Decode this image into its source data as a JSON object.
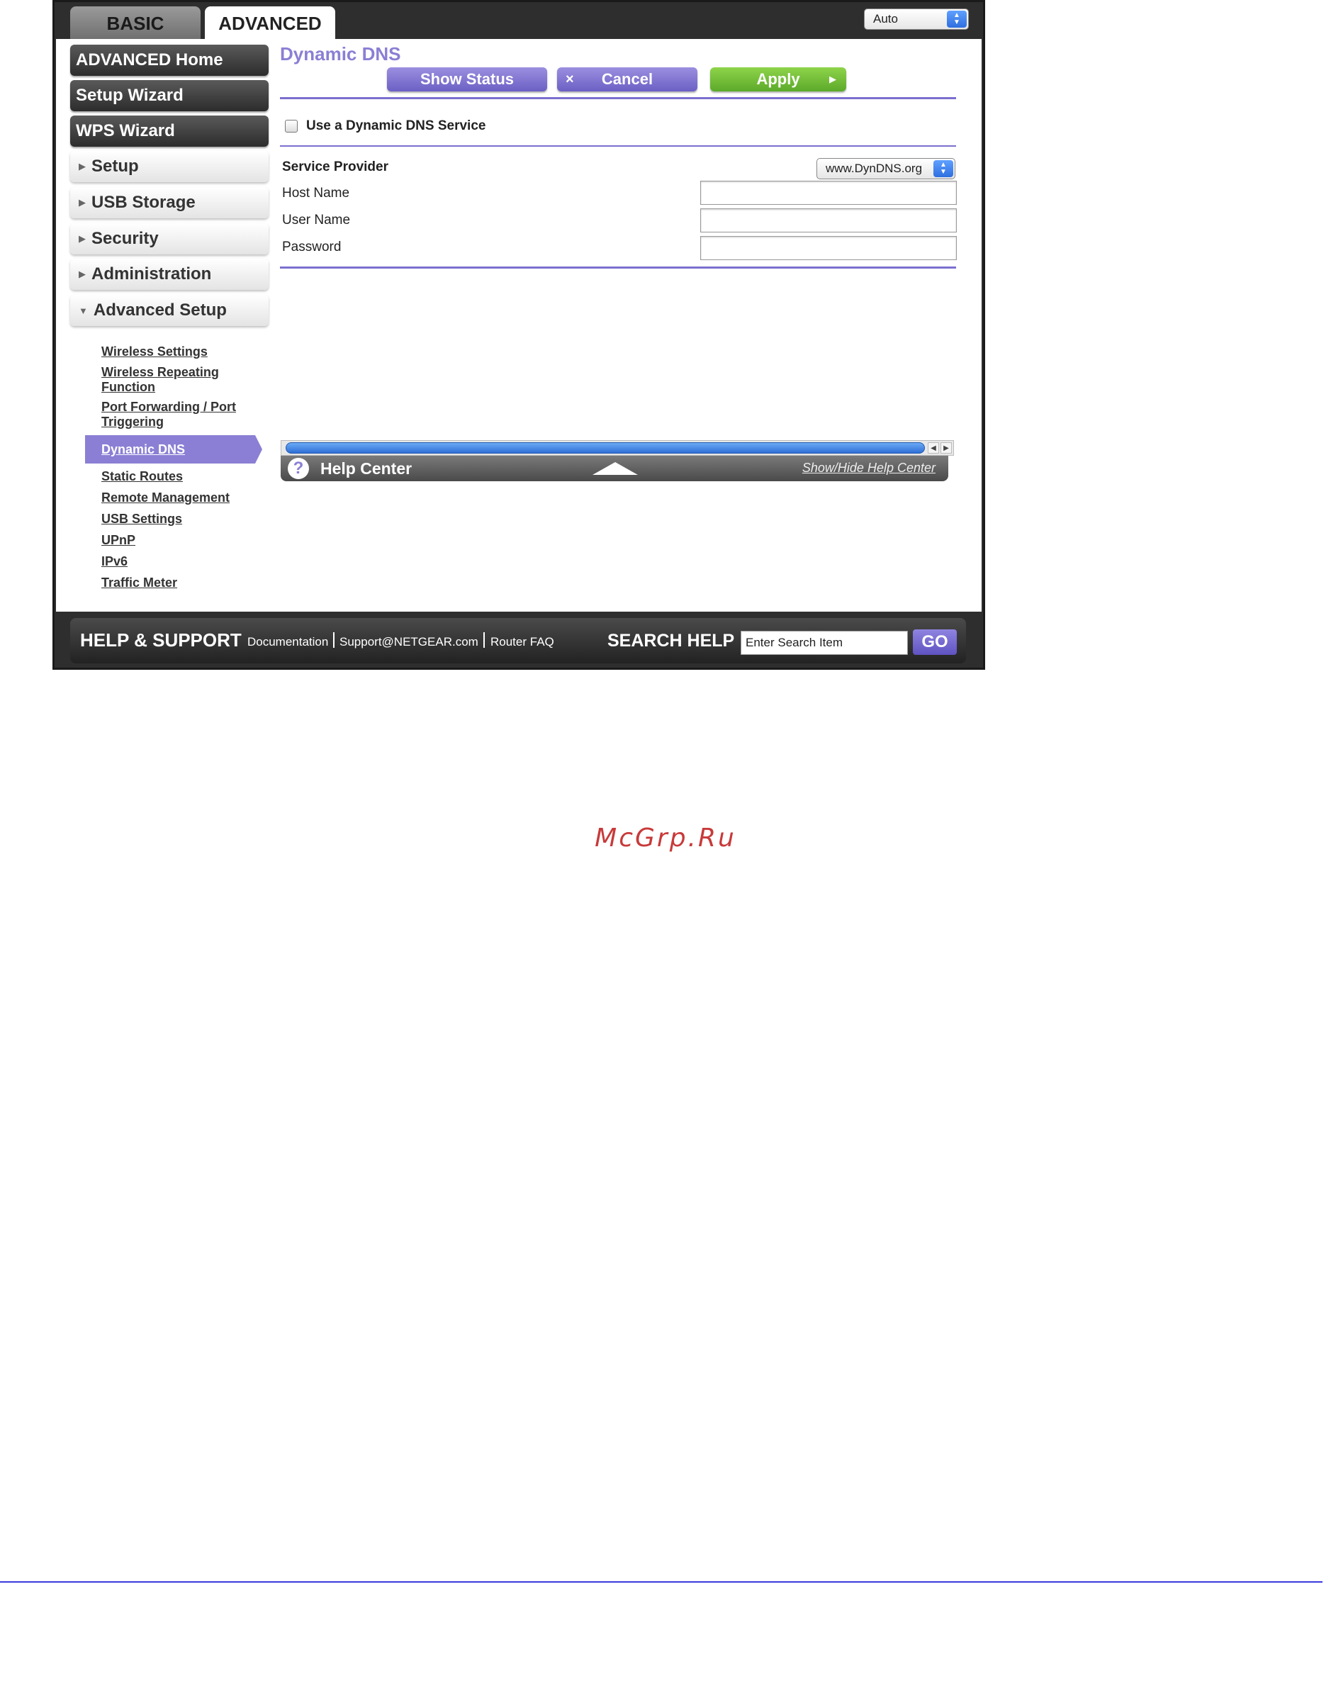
{
  "tabs": {
    "basic": "BASIC",
    "advanced": "ADVANCED"
  },
  "mode_select": {
    "value": "Auto"
  },
  "sidebar": {
    "advanced_home": "ADVANCED Home",
    "setup_wizard": "Setup Wizard",
    "wps_wizard": "WPS Wizard",
    "setup": "Setup",
    "usb_storage": "USB Storage",
    "security": "Security",
    "administration": "Administration",
    "advanced_setup": "Advanced Setup",
    "sub_items": {
      "wireless_settings": "Wireless Settings",
      "wireless_repeating_1": "Wireless Repeating",
      "wireless_repeating_2": "Function",
      "port_forwarding_1": "Port Forwarding / Port",
      "port_forwarding_2": "Triggering",
      "dynamic_dns": "Dynamic DNS",
      "static_routes": "Static Routes",
      "remote_management": "Remote Management",
      "usb_settings": "USB Settings",
      "upnp": "UPnP",
      "ipv6": "IPv6",
      "traffic_meter": "Traffic Meter"
    }
  },
  "main": {
    "title": "Dynamic DNS",
    "buttons": {
      "show_status": "Show Status",
      "cancel": "Cancel",
      "apply": "Apply"
    },
    "use_ddns_label": "Use a Dynamic DNS Service",
    "use_ddns_checked": false,
    "service_provider_label": "Service Provider",
    "service_provider_value": "www.DynDNS.org",
    "host_name_label": "Host Name",
    "host_name_value": "",
    "user_name_label": "User Name",
    "user_name_value": "",
    "password_label": "Password",
    "password_value": ""
  },
  "help_center": {
    "label": "Help Center",
    "toggle": "Show/Hide Help Center"
  },
  "footer": {
    "title": "HELP & SUPPORT",
    "links": [
      "Documentation",
      "Support@NETGEAR.com",
      "Router FAQ"
    ],
    "search_label": "SEARCH HELP",
    "search_value": "Enter Search Item",
    "go": "GO"
  },
  "watermark": "McGrp.Ru",
  "colors": {
    "accent_purple": "#8a7fd4",
    "apply_green": "#6cbb35",
    "frame_dark": "#2e2e2e",
    "watermark_red": "#c83a3a",
    "rule_blue": "#3a3adf"
  },
  "icons": {
    "cancel": "close-icon",
    "apply": "play-arrow-icon",
    "help": "question-icon",
    "collapse_expand": "triangle-icon"
  }
}
